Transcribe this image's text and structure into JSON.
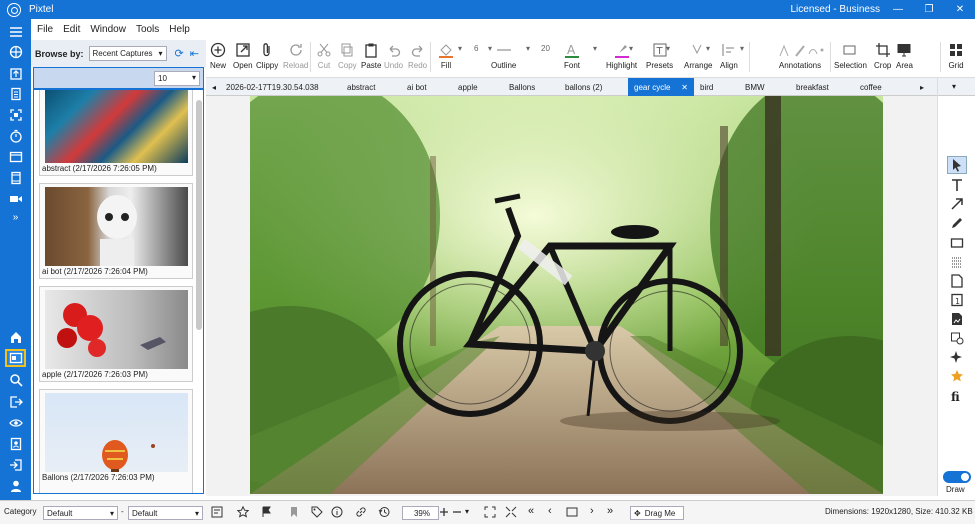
{
  "window": {
    "title": "Pixtel",
    "license": "Licensed - Business",
    "min": "—",
    "restore": "❐",
    "close": "✕"
  },
  "menu": [
    "File",
    "Edit",
    "Window",
    "Tools",
    "Help"
  ],
  "browse": {
    "label": "Browse by:",
    "value": "Recent Captures",
    "count": "10"
  },
  "thumbnails": [
    {
      "caption": "abstract (2/17/2026 7:26:05 PM)"
    },
    {
      "caption": "ai bot (2/17/2026 7:26:04 PM)"
    },
    {
      "caption": "apple (2/17/2026 7:26:03 PM)"
    },
    {
      "caption": "Ballons (2/17/2026 7:26:03 PM)"
    }
  ],
  "toolbar": {
    "new": "New",
    "open": "Open",
    "clippy": "Clippy",
    "reload": "Reload",
    "cut": "Cut",
    "copy": "Copy",
    "paste": "Paste",
    "undo": "Undo",
    "redo": "Redo",
    "fill": "Fill",
    "outline": "Outline",
    "font": "Font",
    "highlight": "Highlight",
    "presets": "Presets",
    "arrange": "Arrange",
    "align": "Align",
    "annotations": "Annotations",
    "selection": "Selection",
    "crop": "Crop",
    "area": "Area",
    "grid": "Grid",
    "outline_width": "6",
    "font_size": "20"
  },
  "tabs": [
    "2026-02-17T19.30.54.038",
    "abstract",
    "ai bot",
    "apple",
    "Ballons",
    "ballons (2)",
    "gear cycle",
    "bird",
    "BMW",
    "breakfast",
    "coffee"
  ],
  "tab_close": "✕",
  "rightbar": {
    "draw": "Draw"
  },
  "status": {
    "category_label": "Category",
    "category_value": "Default",
    "dash": "-",
    "second_value": "Default",
    "zoom": "39%",
    "drag": "Drag Me",
    "dimensions": "Dimensions: 1920x1280, Size: 410.32 KB"
  }
}
